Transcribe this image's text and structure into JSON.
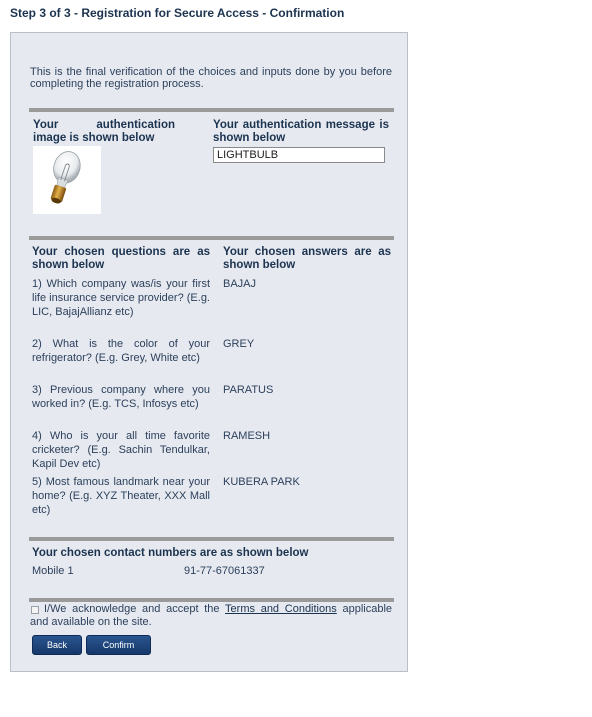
{
  "header": {
    "title": "Step 3 of 3 - Registration for Secure Access - Confirmation"
  },
  "intro": {
    "text": "This is the final verification of the choices and inputs done by you before completing the registration process."
  },
  "auth": {
    "image_label": "Your authentication image is shown below",
    "message_label": "Your authentication message is shown below",
    "image_icon": "lightbulb-image",
    "message_value": "LIGHTBULB"
  },
  "qa": {
    "questions_header": "Your chosen questions are as shown below",
    "answers_header": "Your chosen answers are as shown below",
    "items": [
      {
        "question": "1) Which company was/is your first life insurance service provider? (E.g. LIC, BajajAllianz etc)",
        "answer": "BAJAJ"
      },
      {
        "question": "2) What is the color of your refrigerator? (E.g. Grey, White etc)",
        "answer": "GREY"
      },
      {
        "question": "3) Previous company where you worked in? (E.g. TCS, Infosys etc)",
        "answer": "PARATUS"
      },
      {
        "question": "4) Who is your all time favorite cricketer? (E.g. Sachin Tendulkar, Kapil Dev etc)",
        "answer": "RAMESH"
      },
      {
        "question": "5) Most famous landmark near your home? (E.g. XYZ Theater, XXX Mall etc)",
        "answer": "KUBERA PARK"
      }
    ]
  },
  "contacts": {
    "header": "Your chosen contact numbers are as shown below",
    "items": [
      {
        "label": "Mobile 1",
        "value": "91-77-67061337"
      }
    ]
  },
  "acknowledge": {
    "prefix": "I/We acknowledge and accept the",
    "link": "Terms and Conditions",
    "suffix": "applicable and available on the site."
  },
  "buttons": {
    "back": "Back",
    "confirm": "Confirm"
  },
  "colors": {
    "text": "#1c3350",
    "panel_bg": "#e6eaf0",
    "button": "#1f4a85",
    "divider": "#9a9a9a"
  }
}
